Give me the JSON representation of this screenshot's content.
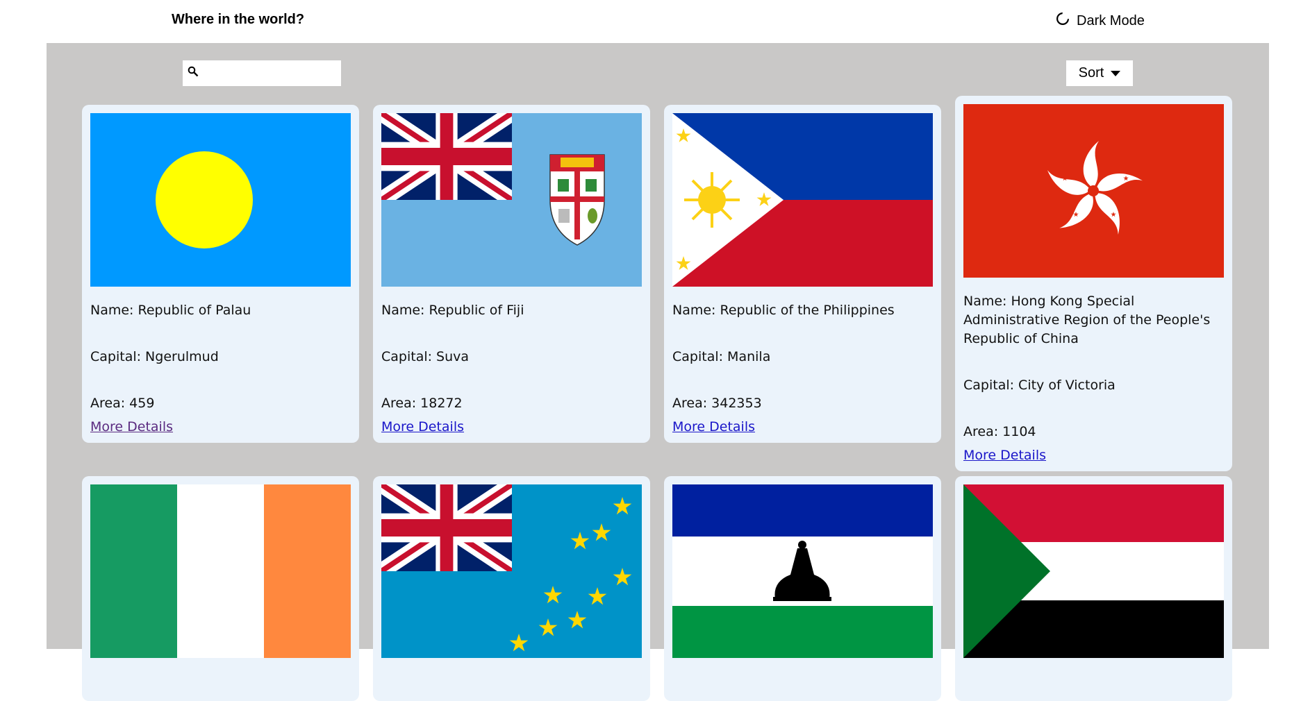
{
  "header": {
    "title": "Where in the world?",
    "mode_label": "Dark Mode",
    "mode_icon": "moon-icon"
  },
  "toolbar": {
    "search_icon": "search-icon",
    "search_value": "",
    "search_placeholder": "",
    "sort_label": "Sort",
    "sort_icon": "caret-down-icon"
  },
  "colors": {
    "page_bg": "#c9c8c7",
    "card_bg": "#ebf3fb",
    "link": "#1a16c9",
    "visited_link": "#5a2a80"
  },
  "countries": [
    {
      "flag": "palau-flag",
      "name": "Name: Republic of Palau",
      "capital": "Capital: Ngerulmud",
      "area": "Area: 459",
      "link": "More Details"
    },
    {
      "flag": "fiji-flag",
      "name": "Name: Republic of Fiji",
      "capital": "Capital: Suva",
      "area": "Area: 18272",
      "link": "More Details"
    },
    {
      "flag": "philippines-flag",
      "name": "Name: Republic of the Philippines",
      "capital": "Capital: Manila",
      "area": "Area: 342353",
      "link": "More Details"
    },
    {
      "flag": "hong-kong-flag",
      "name": "Name: Hong Kong Special Administrative Region of the People's Republic of China",
      "capital": "Capital: City of Victoria",
      "area": "Area: 1104",
      "link": "More Details"
    },
    {
      "flag": "ireland-flag"
    },
    {
      "flag": "tuvalu-flag"
    },
    {
      "flag": "lesotho-flag"
    },
    {
      "flag": "sudan-flag"
    }
  ]
}
